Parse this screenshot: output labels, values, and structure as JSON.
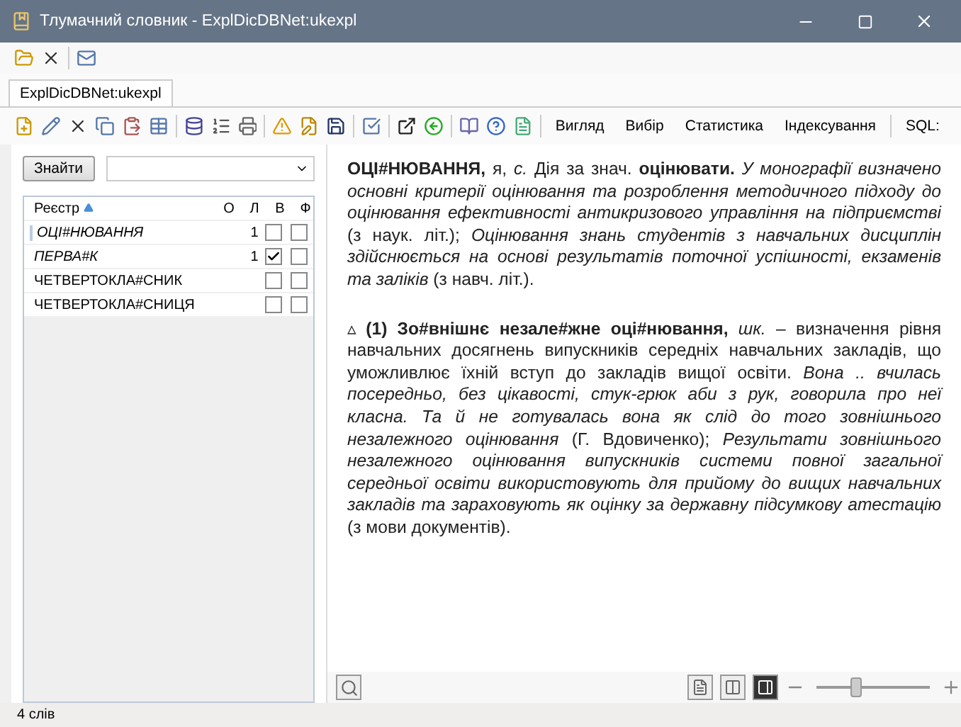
{
  "window": {
    "title": "Тлумачний словник - ExplDicDBNet:ukexpl"
  },
  "document_tabs": [
    {
      "label": "ExplDicDBNet:ukexpl",
      "selected": true
    }
  ],
  "toolbar_menus": [
    "Вигляд",
    "Вибір",
    "Статистика",
    "Індексування",
    "SQL:"
  ],
  "search": {
    "button": "Знайти"
  },
  "word_list": {
    "columns": [
      "Реєстр",
      "О",
      "Л",
      "В",
      "Ф"
    ],
    "rows": [
      {
        "word": "ОЦІ#НЮВАННЯ",
        "italic": true,
        "o": "",
        "l": "1",
        "v": false,
        "f": false,
        "selected": true
      },
      {
        "word": "ПЕРВА#К",
        "italic": true,
        "o": "",
        "l": "1",
        "v": true,
        "f": false,
        "selected": false
      },
      {
        "word": "ЧЕТВЕРТОКЛА#СНИК",
        "italic": false,
        "o": "",
        "l": "",
        "v": false,
        "f": false,
        "selected": false
      },
      {
        "word": "ЧЕТВЕРТОКЛА#СНИЦЯ",
        "italic": false,
        "o": "",
        "l": "",
        "v": false,
        "f": false,
        "selected": false
      }
    ]
  },
  "article": [
    "**ОЦІ#НЮВАННЯ,** я, *с.* Дія за знач. **оцінювати.** *У монографії визначено основні критерії оцінювання та розроблення методичного підходу до оцінювання ефективності антикризового управління на підприємстві* (з наук. літ.); *Оцінювання знань студентів з навчальних дисциплін здійснюється на основі результатів поточної успішності, екзаменів та заліків* (з навч. літ.).",
    "▵ **(1) Зо#внішнє незале#жне оці#нювання,** *шк.* – визначення рівня навчальних досягнень випускників середніх навчальних закладів, що уможливлює їхній вступ до закладів вищої освіти. *Вона .. вчилась посередньо, без цікавості, стук-грюк аби з рук, говорила про неї класна. Та й не готувалась вона як слід до того зовнішнього незалежного оцінювання* (Г. Вдовиченко); *Результати зовнішнього незалежного оцінювання випускників системи повної загальної середньої освіти використовують для прийому до вищих навчальних закладів та зараховують як оцінку за державну підсумкову атестацію* (з мови документів)."
  ],
  "view_buttons": [
    {
      "selected": false
    },
    {
      "selected": false
    },
    {
      "selected": true
    }
  ],
  "zoom": {
    "level": 0.35
  },
  "status_bar": "4 слів"
}
